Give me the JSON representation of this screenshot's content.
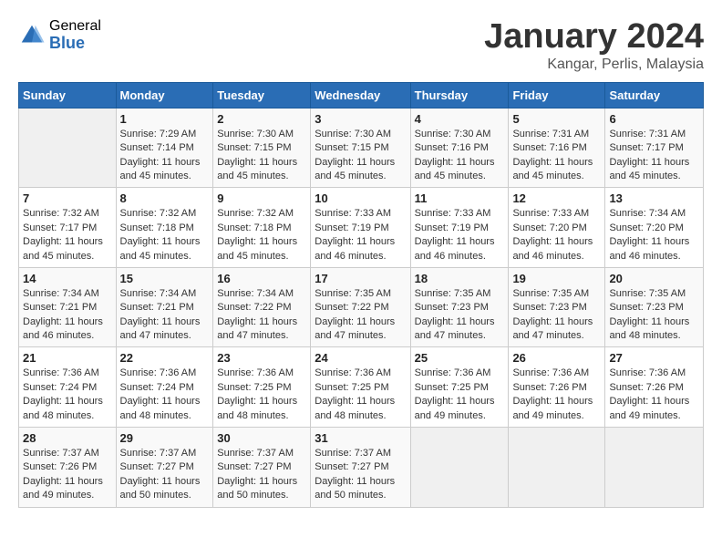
{
  "header": {
    "logo_general": "General",
    "logo_blue": "Blue",
    "title": "January 2024",
    "subtitle": "Kangar, Perlis, Malaysia"
  },
  "columns": [
    "Sunday",
    "Monday",
    "Tuesday",
    "Wednesday",
    "Thursday",
    "Friday",
    "Saturday"
  ],
  "weeks": [
    [
      {
        "num": "",
        "info": ""
      },
      {
        "num": "1",
        "info": "Sunrise: 7:29 AM\nSunset: 7:14 PM\nDaylight: 11 hours and 45 minutes."
      },
      {
        "num": "2",
        "info": "Sunrise: 7:30 AM\nSunset: 7:15 PM\nDaylight: 11 hours and 45 minutes."
      },
      {
        "num": "3",
        "info": "Sunrise: 7:30 AM\nSunset: 7:15 PM\nDaylight: 11 hours and 45 minutes."
      },
      {
        "num": "4",
        "info": "Sunrise: 7:30 AM\nSunset: 7:16 PM\nDaylight: 11 hours and 45 minutes."
      },
      {
        "num": "5",
        "info": "Sunrise: 7:31 AM\nSunset: 7:16 PM\nDaylight: 11 hours and 45 minutes."
      },
      {
        "num": "6",
        "info": "Sunrise: 7:31 AM\nSunset: 7:17 PM\nDaylight: 11 hours and 45 minutes."
      }
    ],
    [
      {
        "num": "7",
        "info": "Sunrise: 7:32 AM\nSunset: 7:17 PM\nDaylight: 11 hours and 45 minutes."
      },
      {
        "num": "8",
        "info": "Sunrise: 7:32 AM\nSunset: 7:18 PM\nDaylight: 11 hours and 45 minutes."
      },
      {
        "num": "9",
        "info": "Sunrise: 7:32 AM\nSunset: 7:18 PM\nDaylight: 11 hours and 45 minutes."
      },
      {
        "num": "10",
        "info": "Sunrise: 7:33 AM\nSunset: 7:19 PM\nDaylight: 11 hours and 46 minutes."
      },
      {
        "num": "11",
        "info": "Sunrise: 7:33 AM\nSunset: 7:19 PM\nDaylight: 11 hours and 46 minutes."
      },
      {
        "num": "12",
        "info": "Sunrise: 7:33 AM\nSunset: 7:20 PM\nDaylight: 11 hours and 46 minutes."
      },
      {
        "num": "13",
        "info": "Sunrise: 7:34 AM\nSunset: 7:20 PM\nDaylight: 11 hours and 46 minutes."
      }
    ],
    [
      {
        "num": "14",
        "info": "Sunrise: 7:34 AM\nSunset: 7:21 PM\nDaylight: 11 hours and 46 minutes."
      },
      {
        "num": "15",
        "info": "Sunrise: 7:34 AM\nSunset: 7:21 PM\nDaylight: 11 hours and 47 minutes."
      },
      {
        "num": "16",
        "info": "Sunrise: 7:34 AM\nSunset: 7:22 PM\nDaylight: 11 hours and 47 minutes."
      },
      {
        "num": "17",
        "info": "Sunrise: 7:35 AM\nSunset: 7:22 PM\nDaylight: 11 hours and 47 minutes."
      },
      {
        "num": "18",
        "info": "Sunrise: 7:35 AM\nSunset: 7:23 PM\nDaylight: 11 hours and 47 minutes."
      },
      {
        "num": "19",
        "info": "Sunrise: 7:35 AM\nSunset: 7:23 PM\nDaylight: 11 hours and 47 minutes."
      },
      {
        "num": "20",
        "info": "Sunrise: 7:35 AM\nSunset: 7:23 PM\nDaylight: 11 hours and 48 minutes."
      }
    ],
    [
      {
        "num": "21",
        "info": "Sunrise: 7:36 AM\nSunset: 7:24 PM\nDaylight: 11 hours and 48 minutes."
      },
      {
        "num": "22",
        "info": "Sunrise: 7:36 AM\nSunset: 7:24 PM\nDaylight: 11 hours and 48 minutes."
      },
      {
        "num": "23",
        "info": "Sunrise: 7:36 AM\nSunset: 7:25 PM\nDaylight: 11 hours and 48 minutes."
      },
      {
        "num": "24",
        "info": "Sunrise: 7:36 AM\nSunset: 7:25 PM\nDaylight: 11 hours and 48 minutes."
      },
      {
        "num": "25",
        "info": "Sunrise: 7:36 AM\nSunset: 7:25 PM\nDaylight: 11 hours and 49 minutes."
      },
      {
        "num": "26",
        "info": "Sunrise: 7:36 AM\nSunset: 7:26 PM\nDaylight: 11 hours and 49 minutes."
      },
      {
        "num": "27",
        "info": "Sunrise: 7:36 AM\nSunset: 7:26 PM\nDaylight: 11 hours and 49 minutes."
      }
    ],
    [
      {
        "num": "28",
        "info": "Sunrise: 7:37 AM\nSunset: 7:26 PM\nDaylight: 11 hours and 49 minutes."
      },
      {
        "num": "29",
        "info": "Sunrise: 7:37 AM\nSunset: 7:27 PM\nDaylight: 11 hours and 50 minutes."
      },
      {
        "num": "30",
        "info": "Sunrise: 7:37 AM\nSunset: 7:27 PM\nDaylight: 11 hours and 50 minutes."
      },
      {
        "num": "31",
        "info": "Sunrise: 7:37 AM\nSunset: 7:27 PM\nDaylight: 11 hours and 50 minutes."
      },
      {
        "num": "",
        "info": ""
      },
      {
        "num": "",
        "info": ""
      },
      {
        "num": "",
        "info": ""
      }
    ]
  ]
}
